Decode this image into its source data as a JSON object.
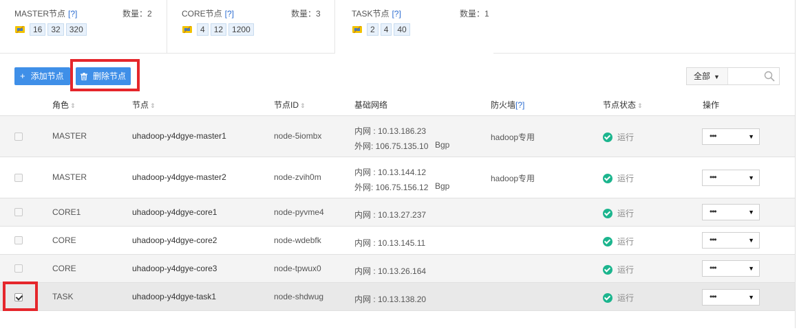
{
  "summary": {
    "cards": [
      {
        "title": "MASTER节点",
        "help": "[?]",
        "count_label": "数量：2",
        "specs": [
          "16",
          "32",
          "320"
        ]
      },
      {
        "title": "CORE节点",
        "help": "[?]",
        "count_label": "数量：3",
        "specs": [
          "4",
          "12",
          "1200"
        ]
      },
      {
        "title": "TASK节点",
        "help": "[?]",
        "count_label": "数量：1",
        "specs": [
          "2",
          "4",
          "40"
        ]
      }
    ]
  },
  "toolbar": {
    "add_label": "添加节点",
    "delete_label": "删除节点",
    "filter_value": "全部",
    "search_placeholder": ""
  },
  "table": {
    "headers": {
      "role": "角色",
      "node": "节点",
      "node_id": "节点ID",
      "network": "基础网络",
      "firewall": "防火墙",
      "firewall_help": "[?]",
      "status": "节点状态",
      "action": "操作"
    },
    "rows": [
      {
        "checked": false,
        "role": "MASTER",
        "node": "uhadoop-y4dgye-master1",
        "node_id": "node-5iombx",
        "net1": "内网 : 10.13.186.23",
        "net2": "外网: 106.75.135.10",
        "net2_tag": "Bgp",
        "firewall": "hadoop专用",
        "status": "运行",
        "action": "•••"
      },
      {
        "checked": false,
        "role": "MASTER",
        "node": "uhadoop-y4dgye-master2",
        "node_id": "node-zvih0m",
        "net1": "内网 : 10.13.144.12",
        "net2": "外网: 106.75.156.12",
        "net2_tag": "Bgp",
        "firewall": "hadoop专用",
        "status": "运行",
        "action": "•••"
      },
      {
        "checked": false,
        "role": "CORE1",
        "node": "uhadoop-y4dgye-core1",
        "node_id": "node-pyvme4",
        "net1": "内网 : 10.13.27.237",
        "net2": "",
        "net2_tag": "",
        "firewall": "",
        "status": "运行",
        "action": "•••"
      },
      {
        "checked": false,
        "role": "CORE",
        "node": "uhadoop-y4dgye-core2",
        "node_id": "node-wdebfk",
        "net1": "内网 : 10.13.145.11",
        "net2": "",
        "net2_tag": "",
        "firewall": "",
        "status": "运行",
        "action": "•••"
      },
      {
        "checked": false,
        "role": "CORE",
        "node": "uhadoop-y4dgye-core3",
        "node_id": "node-tpwux0",
        "net1": "内网 : 10.13.26.164",
        "net2": "",
        "net2_tag": "",
        "firewall": "",
        "status": "运行",
        "action": "•••"
      },
      {
        "checked": true,
        "role": "TASK",
        "node": "uhadoop-y4dgye-task1",
        "node_id": "node-shdwug",
        "net1": "内网 : 10.13.138.20",
        "net2": "",
        "net2_tag": "",
        "firewall": "",
        "status": "运行",
        "action": "•••"
      }
    ]
  },
  "colors": {
    "primary": "#3f8fe8",
    "highlight": "#e5262b",
    "status_ok": "#1cb58e",
    "link": "#2b6cd1"
  }
}
